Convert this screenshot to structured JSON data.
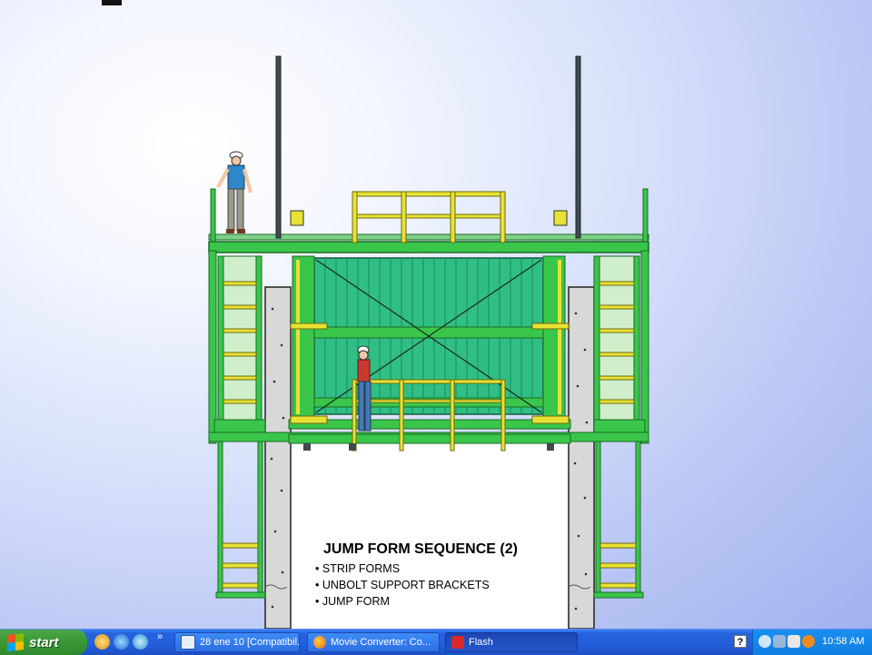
{
  "diagram": {
    "title": "JUMP FORM SEQUENCE  (2)",
    "steps": [
      "STRIP FORMS",
      "UNBOLT SUPPORT BRACKETS",
      "JUMP FORM"
    ]
  },
  "colors": {
    "frame_green": "#39c64a",
    "form_panel": "#2fbf84",
    "rail_yellow": "#e8e235",
    "concrete": "#d8d8d8"
  },
  "taskbar": {
    "start_label": "start",
    "quick_launch": [
      "show-desktop-icon",
      "internet-explorer-icon",
      "media-player-icon"
    ],
    "windows": [
      {
        "label": "28 ene 10 [Compatibil...",
        "icon": "word-document-icon",
        "active": false
      },
      {
        "label": "Movie Converter: Co...",
        "icon": "firefox-icon",
        "active": false
      },
      {
        "label": "Flash",
        "icon": "flash-icon",
        "active": true
      }
    ],
    "help_label": "?",
    "clock": "10:58 AM"
  }
}
